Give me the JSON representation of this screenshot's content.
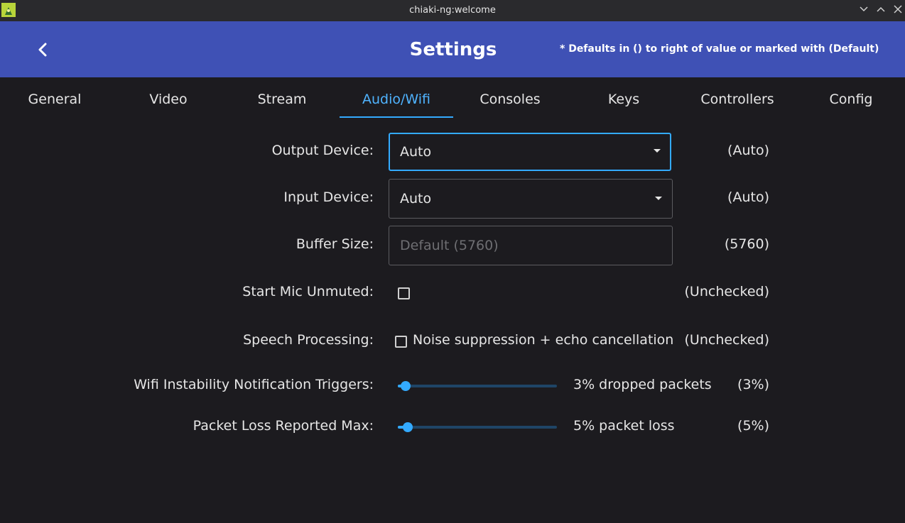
{
  "window": {
    "title": "chiaki-ng:welcome"
  },
  "header": {
    "back_icon": "chevron-left-icon",
    "title": "Settings",
    "defaults_note": "* Defaults in () to right of value or marked with (Default)"
  },
  "tabs": [
    {
      "label": "General",
      "active": false
    },
    {
      "label": "Video",
      "active": false
    },
    {
      "label": "Stream",
      "active": false
    },
    {
      "label": "Audio/Wifi",
      "active": true
    },
    {
      "label": "Consoles",
      "active": false
    },
    {
      "label": "Keys",
      "active": false
    },
    {
      "label": "Controllers",
      "active": false
    },
    {
      "label": "Config",
      "active": false
    }
  ],
  "settings": {
    "output_device": {
      "label": "Output Device:",
      "value": "Auto",
      "default": "(Auto)"
    },
    "input_device": {
      "label": "Input Device:",
      "value": "Auto",
      "default": "(Auto)"
    },
    "buffer_size": {
      "label": "Buffer Size:",
      "placeholder": "Default (5760)",
      "default": "(5760)"
    },
    "start_mic_unmuted": {
      "label": "Start Mic Unmuted:",
      "checked": false,
      "default": "(Unchecked)"
    },
    "speech_processing": {
      "label": "Speech Processing:",
      "checkbox_label": "Noise suppression + echo cancellation",
      "checked": false,
      "default": "(Unchecked)"
    },
    "wifi_instability": {
      "label": "Wifi Instability Notification Triggers:",
      "value_text": "3% dropped packets",
      "level": 0.03,
      "default": "(3%)"
    },
    "packet_loss_max": {
      "label": "Packet Loss Reported Max:",
      "value_text": "5% packet loss",
      "level": 0.05,
      "default": "(5%)"
    }
  },
  "colors": {
    "header_bg": "#3f51b5",
    "accent": "#33aaff",
    "background": "#1c1b1f"
  }
}
